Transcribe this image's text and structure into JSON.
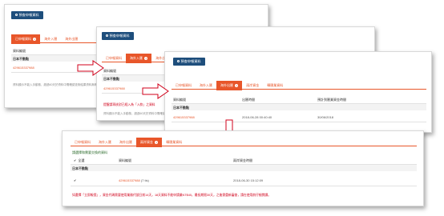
{
  "query_button": "預查申報資料",
  "panel1": {
    "tabs": [
      {
        "label": "已申報資料",
        "badge": "1",
        "active": true
      },
      {
        "label": "海外入匯",
        "badge": "",
        "active": false
      },
      {
        "label": "海外出匯",
        "badge": "",
        "active": false
      }
    ],
    "col_account": "資料編號",
    "group": "日本不動點",
    "link": "429615337988",
    "note": "資料顯示不能入手動核，超過60天於資料中需確認查詢結果資料無明確資料"
  },
  "panel2": {
    "tabs": [
      {
        "label": "已申報資料",
        "badge": "",
        "active": false
      },
      {
        "label": "海外入匯",
        "badge": "1",
        "active": true
      },
      {
        "label": "海外出匯",
        "badge": "",
        "active": false
      }
    ],
    "col_account": "資料編號",
    "group": "日本不動點",
    "link": "429615337988",
    "warning": "提醒請再核對已經入為「入款」之資料",
    "note": "資料顯示不能入手動核，超過60天於資料中需確認"
  },
  "panel3": {
    "tabs": [
      {
        "label": "已申報資料",
        "badge": "",
        "active": false
      },
      {
        "label": "海外入匯",
        "badge": "",
        "active": false
      },
      {
        "label": "海外出匯",
        "badge": "1",
        "active": true
      },
      {
        "label": "兩岸資金",
        "badge": "",
        "active": false
      },
      {
        "label": "轉匯業資料",
        "badge": "",
        "active": false
      }
    ],
    "columns": [
      "資料編號",
      "出匯時間",
      "預計到匯業資金時間"
    ],
    "group": "日本不動點",
    "rows": [
      {
        "id": "429615337988",
        "time": "2018-06-28 00:40:40",
        "expected": "30/06/2018"
      }
    ]
  },
  "panel4": {
    "tabs": [
      {
        "label": "已申報資料",
        "badge": "",
        "active": false
      },
      {
        "label": "海外入匯",
        "badge": "",
        "active": false
      },
      {
        "label": "海外出匯",
        "badge": "",
        "active": false
      },
      {
        "label": "兩岸資金",
        "badge": "1",
        "active": true
      },
      {
        "label": "轉匯業資料",
        "badge": "",
        "active": false
      }
    ],
    "heading": "請選擇和需要交換的資料",
    "columns": [
      "全選",
      "資料編號",
      "兩岸資金時間"
    ],
    "group": "日本不動點",
    "rows": [
      {
        "id": "429615337988",
        "extra": "(7 tls)",
        "time": "2018-06-30 15:12:09"
      }
    ],
    "warning": "如選擇「立即報價」，資金代碼需要使用業務代號日前14天，18天資料不能申請業NT$40，最長期限30天，之後需重新審查，請在使用前仔細閱讀。"
  }
}
